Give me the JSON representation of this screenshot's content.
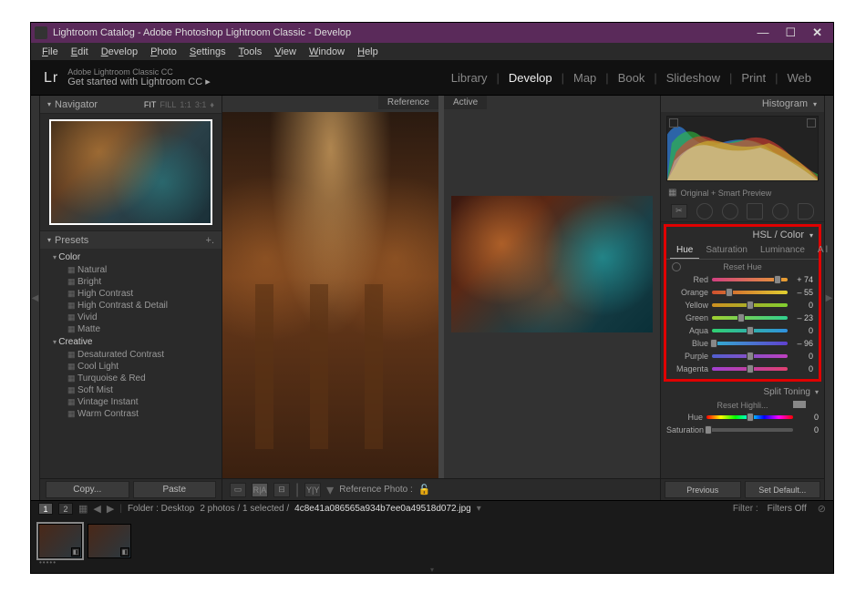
{
  "window": {
    "title": "Lightroom Catalog - Adobe Photoshop Lightroom Classic - Develop"
  },
  "menu": [
    "File",
    "Edit",
    "Develop",
    "Photo",
    "Settings",
    "Tools",
    "View",
    "Window",
    "Help"
  ],
  "topstrip": {
    "logo": "Lr",
    "sub1": "Adobe Lightroom Classic CC",
    "sub2": "Get started with Lightroom CC  ▸"
  },
  "modules": [
    "Library",
    "Develop",
    "Map",
    "Book",
    "Slideshow",
    "Print",
    "Web"
  ],
  "modules_active": "Develop",
  "navigator": {
    "title": "Navigator",
    "ops": [
      "FIT",
      "FILL",
      "1:1",
      "3:1"
    ]
  },
  "presets": {
    "title": "Presets",
    "groups": [
      {
        "name": "Color",
        "items": [
          "Natural",
          "Bright",
          "High Contrast",
          "High Contrast & Detail",
          "Vivid",
          "Matte"
        ]
      },
      {
        "name": "Creative",
        "items": [
          "Desaturated Contrast",
          "Cool Light",
          "Turquoise & Red",
          "Soft Mist",
          "Vintage Instant",
          "Warm Contrast"
        ]
      }
    ]
  },
  "left_buttons": {
    "copy": "Copy...",
    "paste": "Paste"
  },
  "views": {
    "reference": "Reference",
    "active": "Active"
  },
  "center_toolbar": {
    "label": "Reference Photo :"
  },
  "histogram": {
    "title": "Histogram"
  },
  "preview_label": "Original + Smart Preview",
  "hsl": {
    "title": "HSL / Color",
    "tabs": [
      "Hue",
      "Saturation",
      "Luminance",
      "All"
    ],
    "active_tab": "Hue",
    "reset": "Reset Hue",
    "sliders": [
      {
        "label": "Red",
        "value": "+ 74",
        "pos": 87,
        "c1": "#d04080",
        "c2": "#e8a030"
      },
      {
        "label": "Orange",
        "value": "– 55",
        "pos": 23,
        "c1": "#d05030",
        "c2": "#e0d030"
      },
      {
        "label": "Yellow",
        "value": "0",
        "pos": 50,
        "c1": "#d09020",
        "c2": "#80d030"
      },
      {
        "label": "Green",
        "value": "– 23",
        "pos": 38,
        "c1": "#a0d030",
        "c2": "#30d090"
      },
      {
        "label": "Aqua",
        "value": "0",
        "pos": 50,
        "c1": "#30d070",
        "c2": "#3090e0"
      },
      {
        "label": "Blue",
        "value": "– 96",
        "pos": 2,
        "c1": "#30b0d0",
        "c2": "#6040d0"
      },
      {
        "label": "Purple",
        "value": "0",
        "pos": 50,
        "c1": "#5060d0",
        "c2": "#c040c0"
      },
      {
        "label": "Magenta",
        "value": "0",
        "pos": 50,
        "c1": "#a040d0",
        "c2": "#e04070"
      }
    ]
  },
  "split": {
    "title": "Split Toning",
    "reset": "Reset Highli...",
    "sliders": [
      {
        "label": "Hue",
        "value": "0",
        "pos": 50
      },
      {
        "label": "Saturation",
        "value": "0",
        "pos": 2
      }
    ]
  },
  "right_buttons": {
    "prev": "Previous",
    "def": "Set Default..."
  },
  "filmstrip": {
    "pages": [
      "1",
      "2"
    ],
    "folder_lbl": "Folder : Desktop",
    "count": "2 photos / 1 selected /",
    "file": "4c8e41a086565a934b7ee0a49518d072.jpg",
    "filter_lbl": "Filter :",
    "filter_val": "Filters Off"
  }
}
